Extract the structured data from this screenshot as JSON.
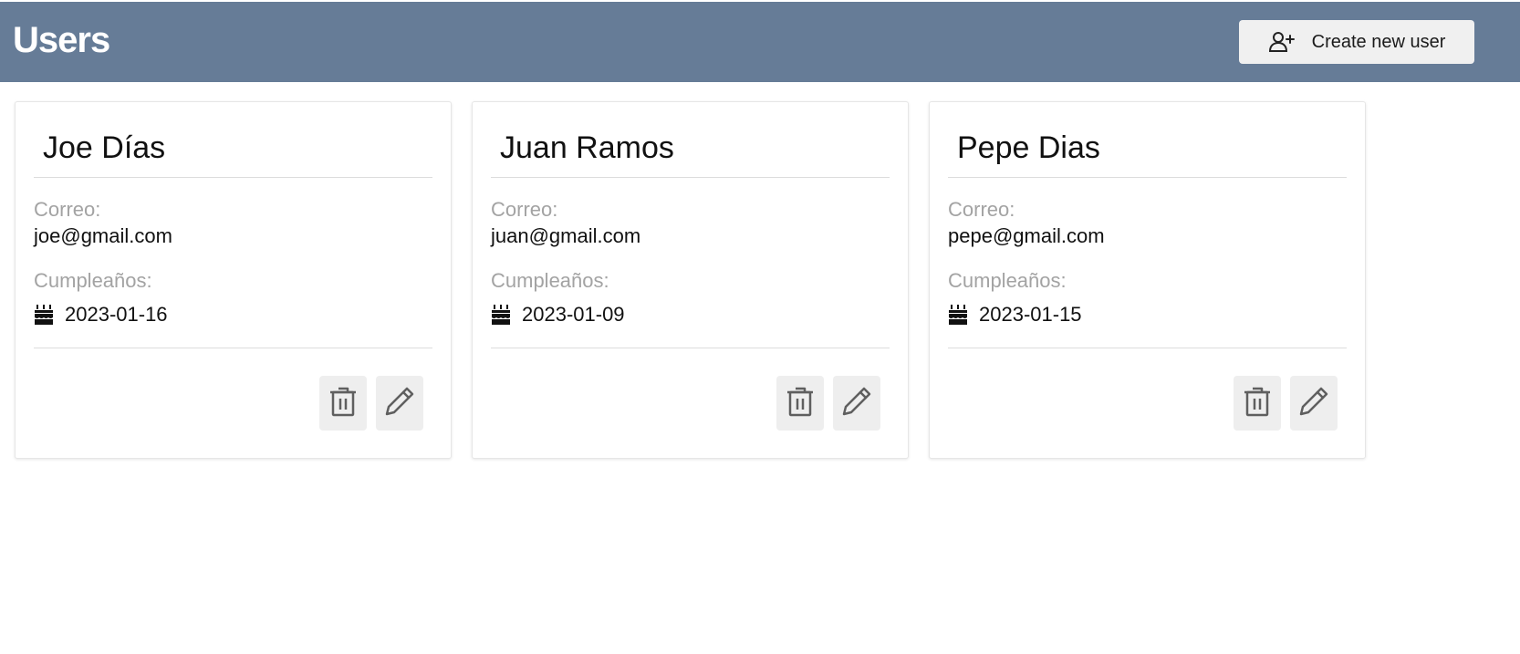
{
  "header": {
    "title": "Users",
    "create_button_label": "Create new user",
    "create_button_icon": "person-add-icon",
    "background_color": "#667c97"
  },
  "users": [
    {
      "name": "Joe Días",
      "email_label": "Correo:",
      "email": "joe@gmail.com",
      "birthday_label": "Cumpleaños:",
      "birthday": "2023-01-16",
      "birthday_icon": "cake-icon",
      "delete_icon": "trash-icon",
      "edit_icon": "pencil-icon"
    },
    {
      "name": "Juan Ramos",
      "email_label": "Correo:",
      "email": "juan@gmail.com",
      "birthday_label": "Cumpleaños:",
      "birthday": "2023-01-09",
      "birthday_icon": "cake-icon",
      "delete_icon": "trash-icon",
      "edit_icon": "pencil-icon"
    },
    {
      "name": "Pepe Dias",
      "email_label": "Correo:",
      "email": "pepe@gmail.com",
      "birthday_label": "Cumpleaños:",
      "birthday": "2023-01-15",
      "birthday_icon": "cake-icon",
      "delete_icon": "trash-icon",
      "edit_icon": "pencil-icon"
    }
  ]
}
